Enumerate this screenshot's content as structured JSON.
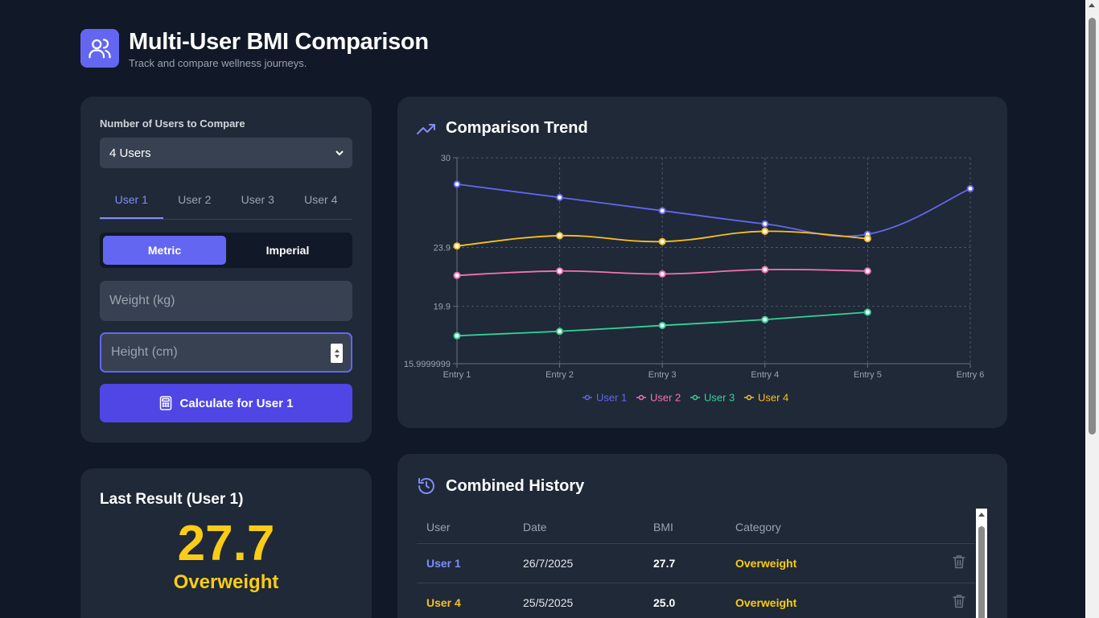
{
  "header": {
    "title": "Multi-User BMI Comparison",
    "subtitle": "Track and compare wellness journeys.",
    "logo_icon": "users-icon"
  },
  "input_panel": {
    "users_label": "Number of Users to Compare",
    "users_select_value": "4 Users",
    "user_tabs": [
      "User 1",
      "User 2",
      "User 3",
      "User 4"
    ],
    "active_user_tab": "User 1",
    "unit_options": [
      "Metric",
      "Imperial"
    ],
    "active_unit": "Metric",
    "weight_placeholder": "Weight (kg)",
    "height_placeholder": "Height (cm)",
    "calculate_label": "Calculate for User 1",
    "calculate_icon": "calculator-icon"
  },
  "last_result": {
    "title": "Last Result (User 1)",
    "bmi": "27.7",
    "category": "Overweight"
  },
  "chart_panel": {
    "title": "Comparison Trend",
    "icon": "trending-up-icon"
  },
  "chart_data": {
    "type": "line",
    "categories": [
      "Entry 1",
      "Entry 2",
      "Entry 3",
      "Entry 4",
      "Entry 5",
      "Entry 6"
    ],
    "y_ticks": [
      {
        "value": 30,
        "label": "30"
      },
      {
        "value": 23.9,
        "label": "23.9"
      },
      {
        "value": 19.9,
        "label": "19.9"
      },
      {
        "value": 15.9999999,
        "label": "15.9999999"
      }
    ],
    "ylim": [
      15.9999999,
      30
    ],
    "grid": true,
    "legend_position": "bottom",
    "series": [
      {
        "name": "User 1",
        "color": "#6366f1",
        "values": [
          28.2,
          27.3,
          26.4,
          25.5,
          24.8,
          27.9
        ]
      },
      {
        "name": "User 2",
        "color": "#f472b6",
        "values": [
          22.0,
          22.3,
          22.1,
          22.4,
          22.3
        ]
      },
      {
        "name": "User 3",
        "color": "#34d399",
        "values": [
          17.9,
          18.2,
          18.6,
          19.0,
          19.5
        ]
      },
      {
        "name": "User 4",
        "color": "#fbbf24",
        "values": [
          24.0,
          24.7,
          24.3,
          25.0,
          24.5
        ]
      }
    ]
  },
  "history": {
    "title": "Combined History",
    "icon": "history-icon",
    "columns": [
      "User",
      "Date",
      "BMI",
      "Category"
    ],
    "rows": [
      {
        "user": "User 1",
        "user_color": "#818cf8",
        "date": "26/7/2025",
        "bmi": "27.7",
        "category": "Overweight",
        "category_color": "#facc15"
      },
      {
        "user": "User 4",
        "user_color": "#fbbf24",
        "date": "25/5/2025",
        "bmi": "25.0",
        "category": "Overweight",
        "category_color": "#facc15"
      }
    ]
  }
}
